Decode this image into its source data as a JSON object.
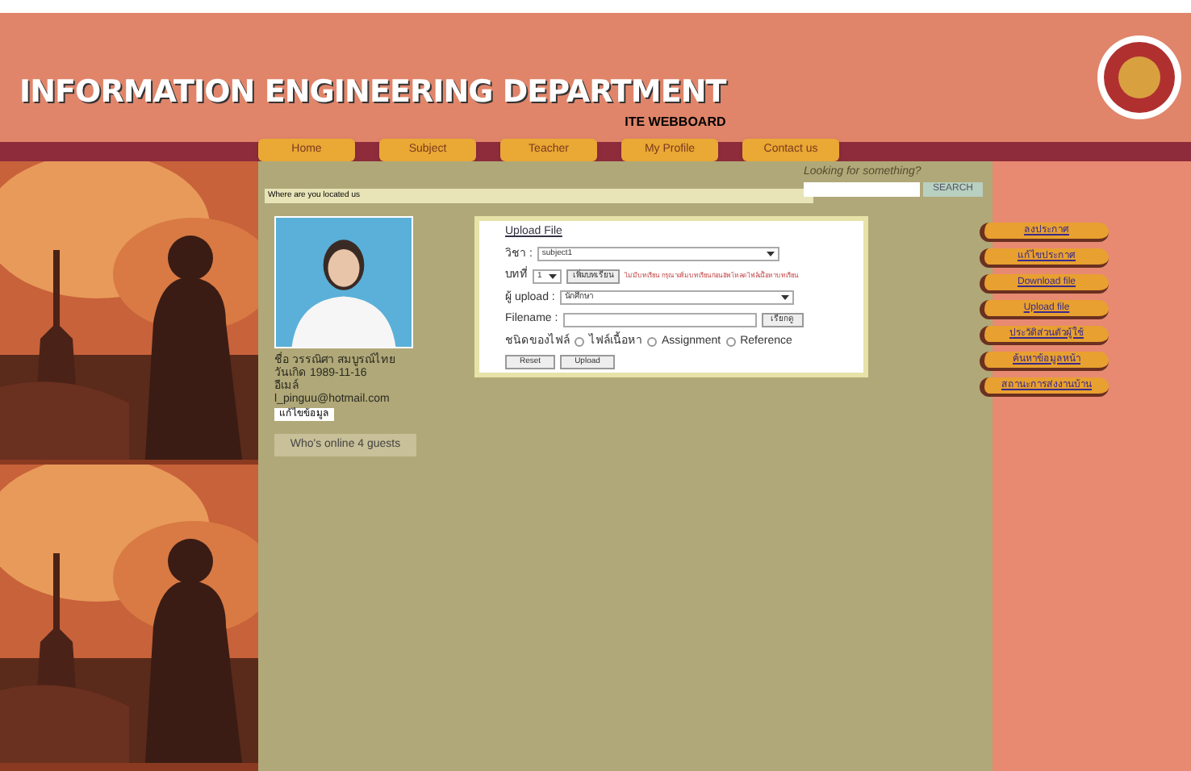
{
  "header": {
    "title": "INFORMATION ENGINEERING DEPARTMENT",
    "subtitle": "ITE WEBBOARD"
  },
  "nav": [
    {
      "label": "Home"
    },
    {
      "label": "Subject"
    },
    {
      "label": "Teacher"
    },
    {
      "label": "My Profile"
    },
    {
      "label": "Contact us"
    }
  ],
  "search": {
    "label": "Looking for something?",
    "button": "SEARCH"
  },
  "breadcrumb": "Where are you located us",
  "profile": {
    "lines": [
      "ชื่อ วรรณิศา สมบูรณ์ไทย",
      "วันเกิด 1989-11-16",
      "อีเมล์",
      "l_pinguu@hotmail.com"
    ],
    "edit_button": "แก้ไขข้อมูล",
    "online": "Who's online 4 guests"
  },
  "upload_form": {
    "title": "Upload File",
    "subject": {
      "label": "วิชา :",
      "value": "subject1"
    },
    "chapter": {
      "label": "บทที่",
      "value": "1",
      "button": "เพิ่มบทเรียน",
      "note": "ไม่มีบทเรียน กรุณาเพิ่มบทเรียนก่อนอัพโหลดไฟล์เนื้อหาบทเรียน"
    },
    "uploader": {
      "label": "ผู้ upload :",
      "value": "นักศึกษา"
    },
    "filename": {
      "label": "Filename :",
      "button": "เรียกดู"
    },
    "file_type": {
      "label": "ชนิดของไฟล์",
      "options": [
        {
          "label": "ไฟล์เนื้อหา",
          "selected": false
        },
        {
          "label": "Assignment",
          "selected": false
        },
        {
          "label": "Reference",
          "selected": false
        }
      ]
    },
    "buttons": [
      "Reset",
      "Upload"
    ]
  },
  "side_menu": [
    {
      "label": "ลงประกาศ"
    },
    {
      "label": "แก้ไขประกาศ"
    },
    {
      "label": "Download file"
    },
    {
      "label": "Upload file"
    },
    {
      "label": "ประวัติส่วนตัวผู้ใช้"
    },
    {
      "label": "ค้นหาข้อมูลหน้า"
    },
    {
      "label": "สถานะการส่งงานบ้าน"
    }
  ]
}
